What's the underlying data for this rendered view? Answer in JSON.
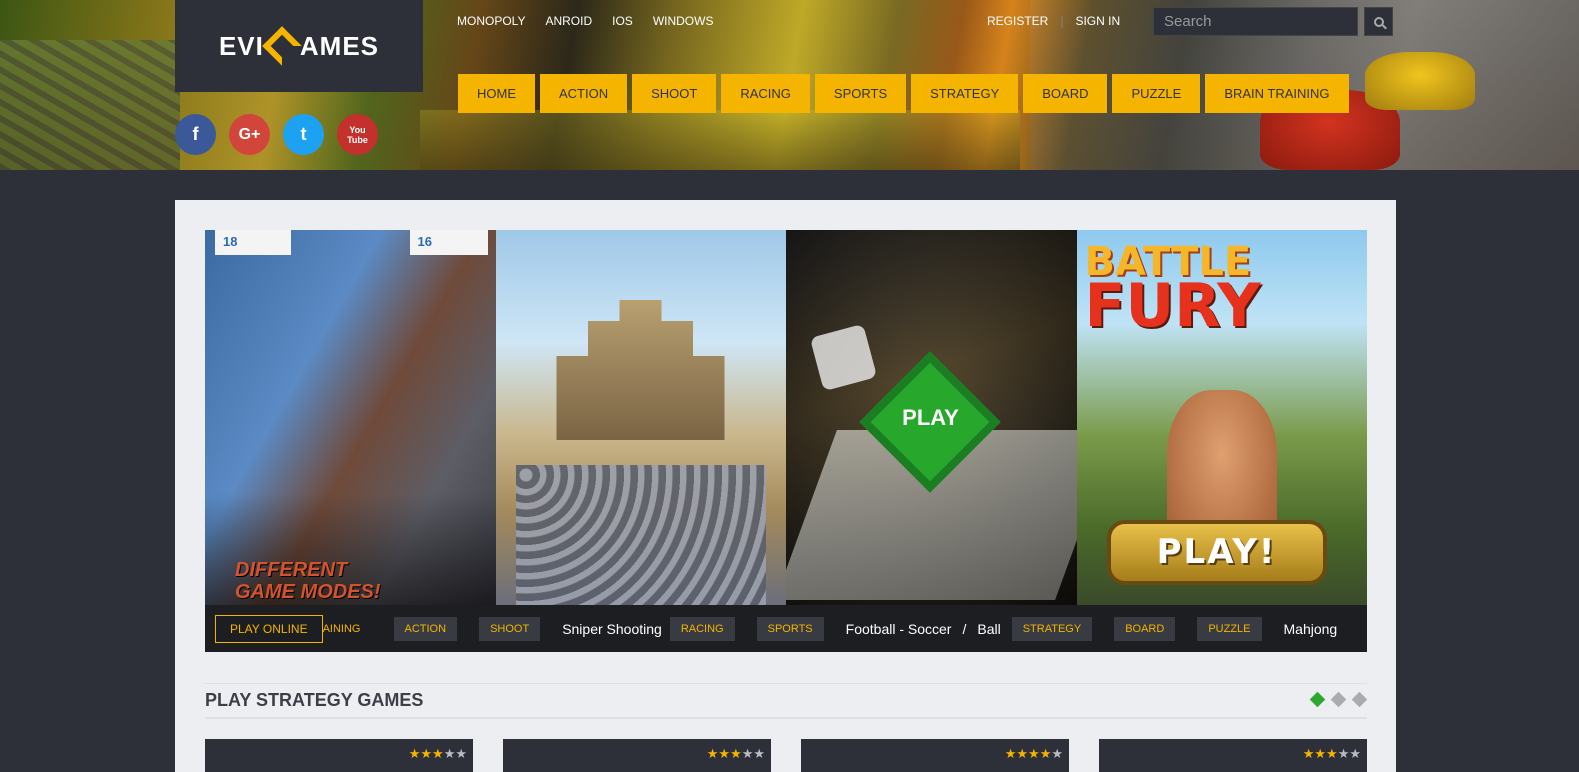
{
  "brand": {
    "logo_left": "EVI",
    "logo_right": "AMES"
  },
  "topnav": [
    "MONOPOLY",
    "ANROID",
    "IOS",
    "WINDOWS"
  ],
  "auth": {
    "register": "REGISTER",
    "sign_in": "SIGN IN"
  },
  "search": {
    "placeholder": "Search"
  },
  "social": {
    "facebook": "f",
    "google": "G+",
    "twitter": "t",
    "youtube_top": "You",
    "youtube_bottom": "Tube"
  },
  "categories": [
    "HOME",
    "ACTION",
    "SHOOT",
    "RACING",
    "SPORTS",
    "STRATEGY",
    "BOARD",
    "PUZZLE",
    "BRAIN TRAINING"
  ],
  "slides": {
    "s1": {
      "score_left": "18",
      "score_right": "16",
      "caption_1": "DIFFERENT",
      "caption_2": "GAME MODES!"
    },
    "s3": {
      "play_label": "PLAY"
    },
    "s4": {
      "title_1": "BATTLE",
      "title_2": "FURY",
      "play_button": "PLAY!"
    }
  },
  "ticker": {
    "play_online": "PLAY ONLINE",
    "partial_tag": "AINING",
    "action": "ACTION",
    "shoot": "SHOOT",
    "sniper": "Sniper Shooting",
    "racing": "RACING",
    "sports": "SPORTS",
    "football": "Football - Soccer",
    "slash": "/",
    "ball": "Ball",
    "strategy": "STRATEGY",
    "board": "BOARD",
    "puzzle": "PUZZLE",
    "mahjong": "Mahjong"
  },
  "section": {
    "title": "PLAY STRATEGY GAMES"
  },
  "cards": [
    {
      "rating": 3
    },
    {
      "rating": 3
    },
    {
      "rating": 4
    },
    {
      "rating": 3
    }
  ],
  "colors": {
    "accent": "#f4b400",
    "bg": "#2d3039",
    "panel": "#eceef2",
    "active_dot": "#2fa82f"
  }
}
